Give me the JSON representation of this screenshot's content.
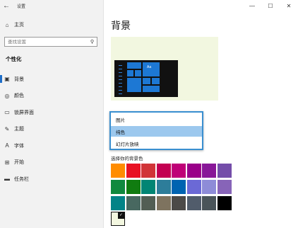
{
  "window": {
    "app_title": "设置",
    "back_icon": "←",
    "minimize_icon": "—",
    "maximize_icon": "☐",
    "close_icon": "✕"
  },
  "sidebar": {
    "home_label": "主页",
    "search_placeholder": "查找设置",
    "section_title": "个性化",
    "items": [
      {
        "label": "背景",
        "icon": "image-icon",
        "glyph": "▣",
        "active": true
      },
      {
        "label": "颜色",
        "icon": "palette-icon",
        "glyph": "◎",
        "active": false
      },
      {
        "label": "锁屏界面",
        "icon": "lock-screen-icon",
        "glyph": "▭",
        "active": false
      },
      {
        "label": "主题",
        "icon": "theme-brush-icon",
        "glyph": "✎",
        "active": false
      },
      {
        "label": "字体",
        "icon": "font-icon",
        "glyph": "A",
        "active": false
      },
      {
        "label": "开始",
        "icon": "start-icon",
        "glyph": "⊞",
        "active": false
      },
      {
        "label": "任务栏",
        "icon": "taskbar-icon",
        "glyph": "▬",
        "active": false
      }
    ]
  },
  "main": {
    "title": "背景",
    "preview_tile_label": "Aa",
    "dropdown": {
      "options": [
        "图片",
        "纯色",
        "幻灯片放映"
      ],
      "selected": "纯色"
    },
    "color_label": "选择你的背景色",
    "swatch_colors": [
      [
        "#ff8c00",
        "#e81123",
        "#d13438",
        "#c30052",
        "#bf0077",
        "#9a0089",
        "#881798",
        "#744da9"
      ],
      [
        "#10893e",
        "#107c10",
        "#018574",
        "#2d7d9a",
        "#0063b1",
        "#6b69d6",
        "#8e8cd8",
        "#8764b8"
      ],
      [
        "#038387",
        "#486860",
        "#525e54",
        "#7e735f",
        "#4c4a48",
        "#515c6b",
        "#4a5459",
        "#000000"
      ]
    ],
    "custom_color": "#f3f7e0"
  },
  "colors": {
    "accent": "#1f6fc8",
    "sidebar_bg": "#f2f2f2",
    "dropdown_border": "#3a8fd0",
    "dropdown_selected": "#9cc8ee"
  }
}
